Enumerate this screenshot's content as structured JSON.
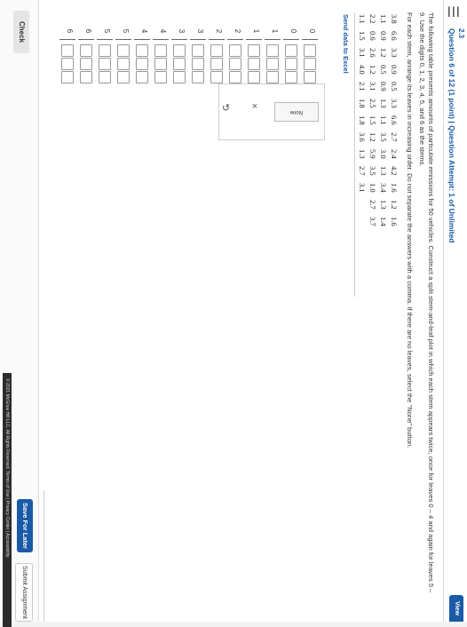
{
  "header": {
    "section": "2.3",
    "question_title": "Question 6 of 12 (1 point)  |  Question Attempt: 1 of Unlimited",
    "view_button": "View"
  },
  "instructions": {
    "paragraph1": "The following table presents amounts of particulate emissions for 50 vehicles. Construct a split stem-and-leaf plot in which each stem appears twice, once for leaves 0 – 4 and again for leaves 5 – 9. Use the digits 0, 1, 2, 3, 4, 5, and 6 as the stems.",
    "paragraph2": "For each stem, arrange its leaves in increasing order. Do not separate the answers with a comma. If there are no leaves, select the \"None\" button."
  },
  "table": {
    "rows": [
      [
        "3.8",
        "6.6",
        "3.3",
        "0.9",
        "0.5",
        "3.3",
        "6.6",
        "2.7",
        "2.4",
        "4.2",
        "1.6",
        "1.2",
        "1.6"
      ],
      [
        "1.1",
        "0.9",
        "1.2",
        "0.5",
        "0.9",
        "1.3",
        "1.1",
        "3.5",
        "3.0",
        "1.3",
        "3.4",
        "1.3",
        "1.4"
      ],
      [
        "2.2",
        "0.6",
        "2.6",
        "1.2",
        "3.1",
        "2.5",
        "1.5",
        "1.2",
        "5.9",
        "3.5",
        "1.0",
        "2.7",
        "3.7"
      ],
      [
        "1.1",
        "1.5",
        "3.1",
        "4.0",
        "2.1",
        "1.8",
        "1.8",
        "3.6",
        "1.3",
        "2.7",
        "3.1"
      ]
    ]
  },
  "excel_link": "Send data to Excel",
  "plot": {
    "stems": [
      "0",
      "0",
      "1",
      "1",
      "2",
      "2",
      "3",
      "3",
      "4",
      "4",
      "5",
      "5",
      "6",
      "6"
    ]
  },
  "palette": {
    "none_label": "None",
    "clear_symbol": "×",
    "undo_symbol": "↺"
  },
  "footer": {
    "check": "Check",
    "save": "Save For Later",
    "submit": "Submit Assignment",
    "copyright": "© 2021 McGraw Hill LLC. All Rights Reserved.   Terms of Use  |  Privacy Center  |  Accessibility"
  },
  "colors": {
    "accent": "#1a5aa6"
  }
}
